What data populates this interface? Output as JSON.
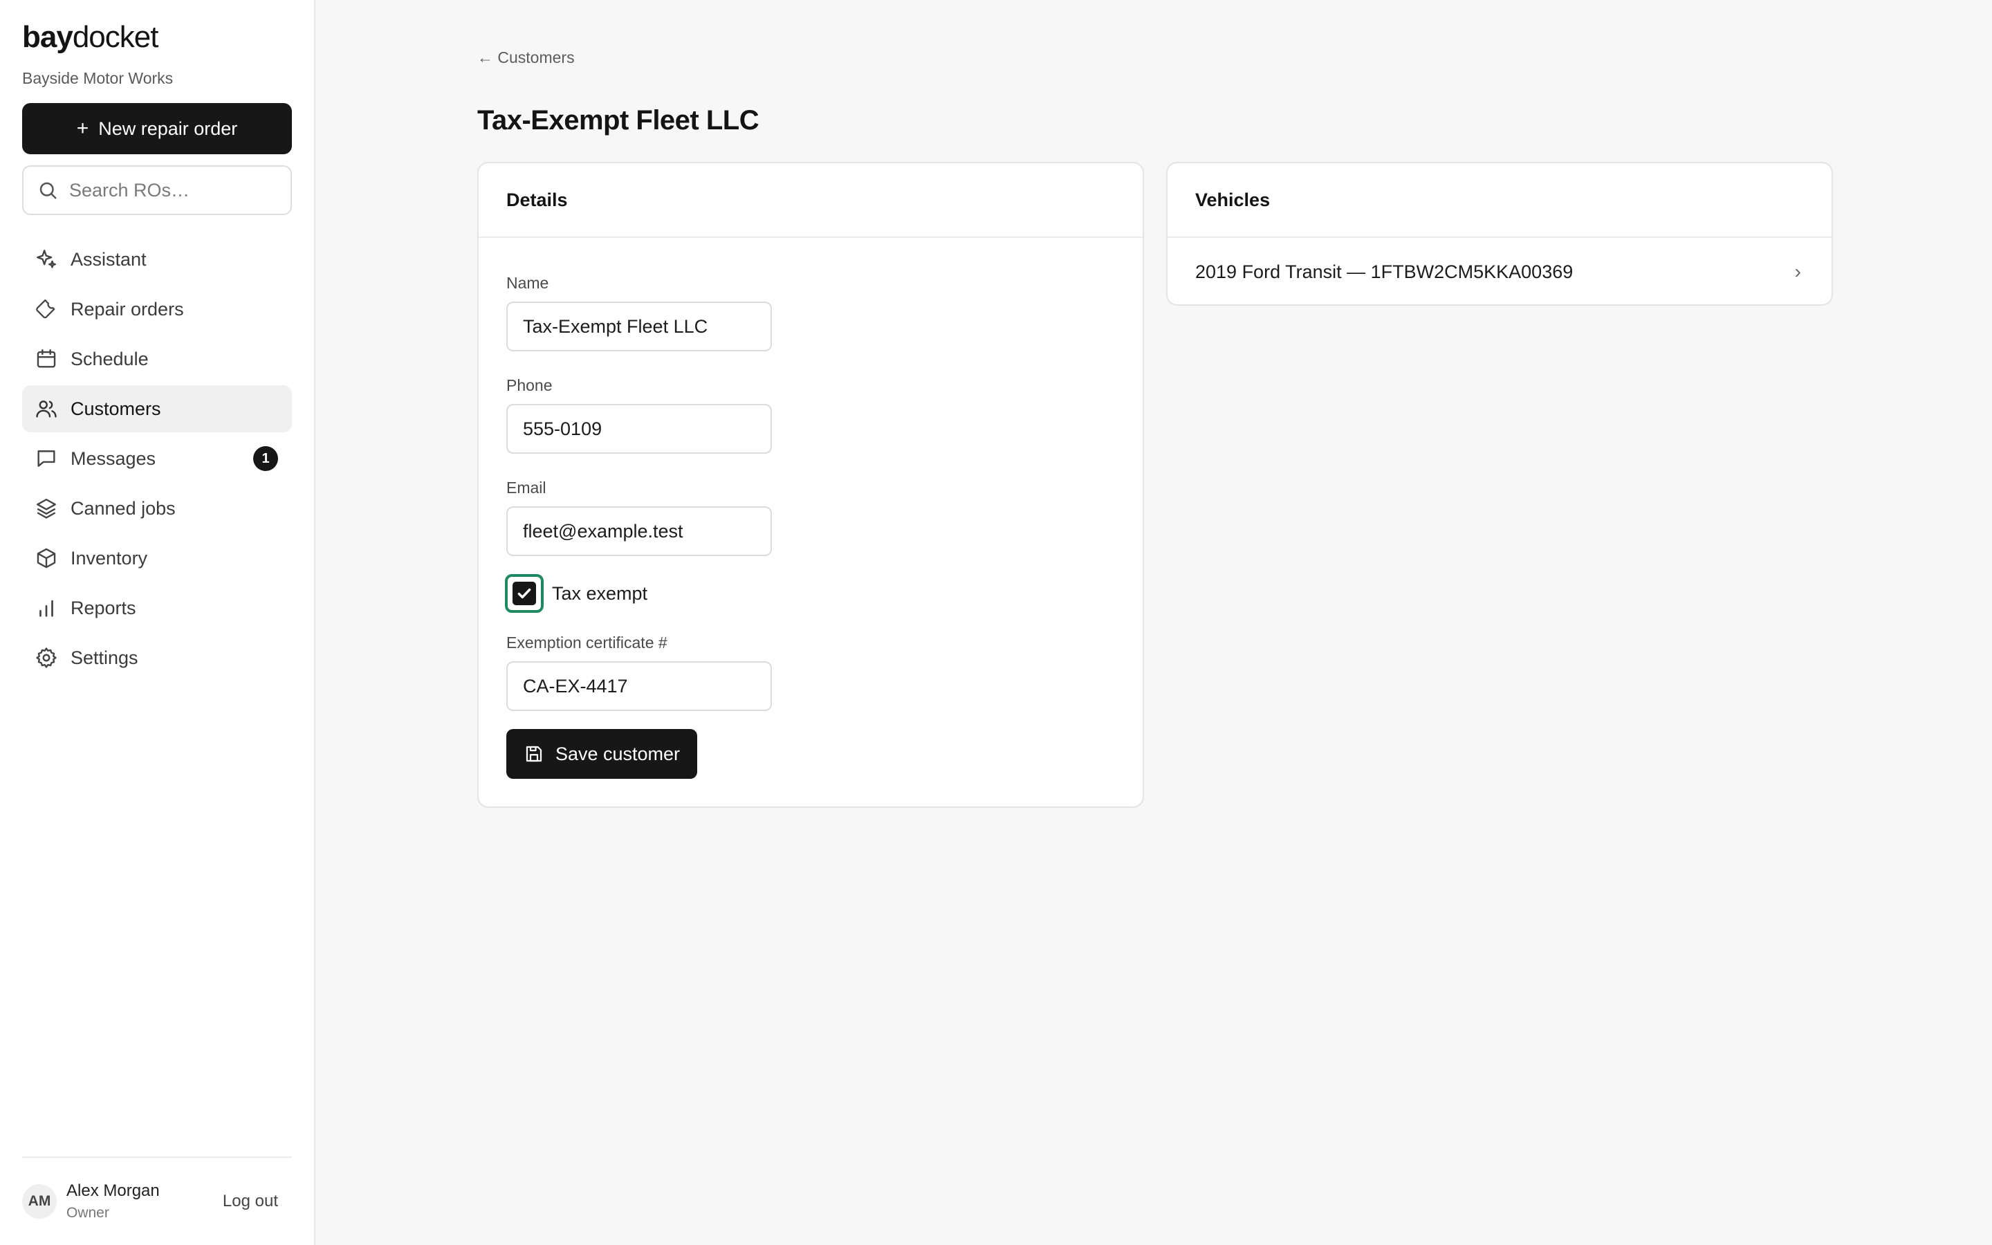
{
  "brand": {
    "bold": "bay",
    "light": "docket"
  },
  "shop_name": "Bayside Motor Works",
  "new_ro_label": "New repair order",
  "search_placeholder": "Search ROs…",
  "nav": [
    {
      "label": "Assistant",
      "icon": "sparkle-icon"
    },
    {
      "label": "Repair orders",
      "icon": "wrench-icon"
    },
    {
      "label": "Schedule",
      "icon": "calendar-icon"
    },
    {
      "label": "Customers",
      "icon": "users-icon",
      "active": true
    },
    {
      "label": "Messages",
      "icon": "message-icon",
      "badge": "1"
    },
    {
      "label": "Canned jobs",
      "icon": "layers-icon"
    },
    {
      "label": "Inventory",
      "icon": "box-icon"
    },
    {
      "label": "Reports",
      "icon": "bar-chart-icon"
    },
    {
      "label": "Settings",
      "icon": "gear-icon"
    }
  ],
  "user": {
    "initials": "AM",
    "name": "Alex Morgan",
    "role": "Owner",
    "logout": "Log out"
  },
  "back_link": "← Customers",
  "page_title": "Tax-Exempt Fleet LLC",
  "details": {
    "heading": "Details",
    "name_label": "Name",
    "name_value": "Tax-Exempt Fleet LLC",
    "phone_label": "Phone",
    "phone_value": "555-0109",
    "email_label": "Email",
    "email_value": "fleet@example.test",
    "tax_exempt_label": "Tax exempt",
    "tax_exempt_checked": true,
    "cert_label": "Exemption certificate #",
    "cert_value": "CA-EX-4417",
    "save_label": "Save customer"
  },
  "vehicles": {
    "heading": "Vehicles",
    "items": [
      {
        "label": "2019 Ford Transit — 1FTBW2CM5KKA00369"
      }
    ]
  },
  "colors": {
    "primary": "#171717",
    "focus_ring": "#1f8a62",
    "background": "#f7f7f7"
  }
}
